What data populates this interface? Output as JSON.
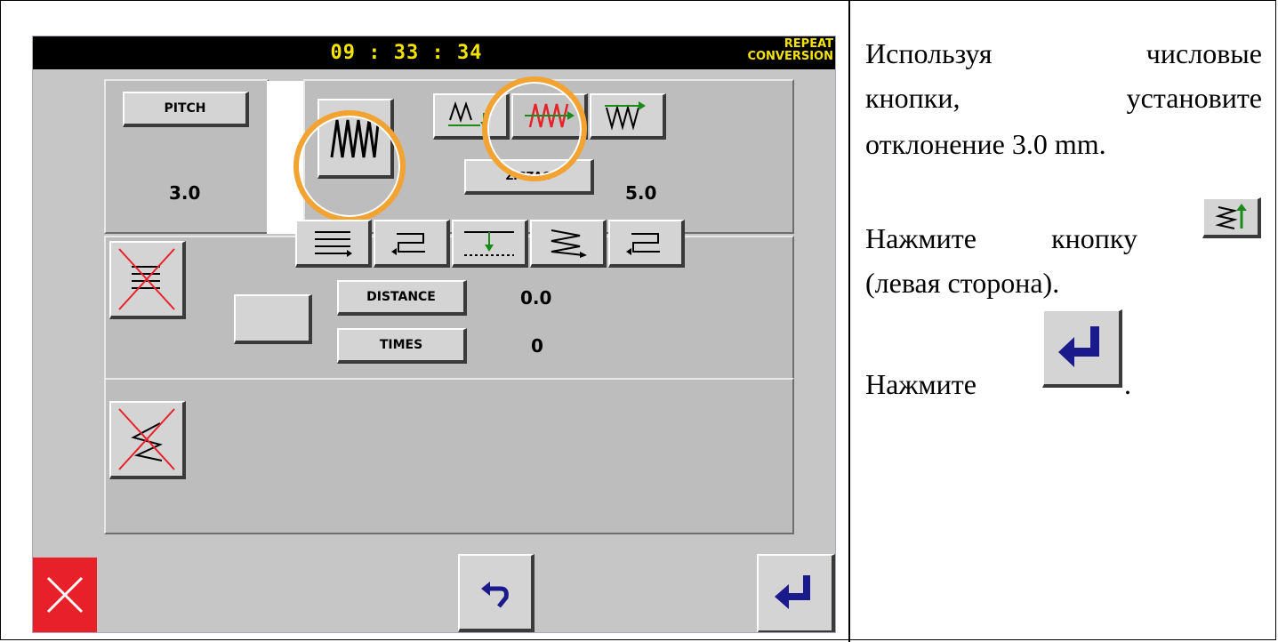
{
  "screen": {
    "clock": "09 : 33 : 34",
    "mode_line1": "REPEAT",
    "mode_line2": "CONVERSION"
  },
  "pitch": {
    "button_label": "PITCH",
    "value": "3.0"
  },
  "zigzag": {
    "button_label": "ZIGZAG",
    "value": "5.0"
  },
  "repeat": {
    "distance_label": "DISTANCE",
    "distance_value": "0.0",
    "times_label": "TIMES",
    "times_value": "0"
  },
  "instructions": {
    "line1_word1": "Используя",
    "line1_word2": "числовые",
    "line2_word1": "кнопки,",
    "line2_word2": "установите",
    "line3": "отклонение 3.0 mm.",
    "press_word": "Нажмите",
    "press_word2": "кнопку",
    "left_side": "(левая сторона).",
    "press_enter": "Нажмите",
    "period": "."
  },
  "icons": {
    "cancel": "close-icon",
    "undo": "undo-arrow-icon",
    "enter": "enter-return-icon",
    "zigzag_pattern": "zigzag-icon",
    "repeat_pattern": "multi-line-repeat-icon"
  },
  "colors": {
    "clock_text": "#f4e300",
    "highlight_circle": "#f2a332",
    "cancel_red": "#e8202a",
    "enter_blue": "#1a1a8c"
  }
}
